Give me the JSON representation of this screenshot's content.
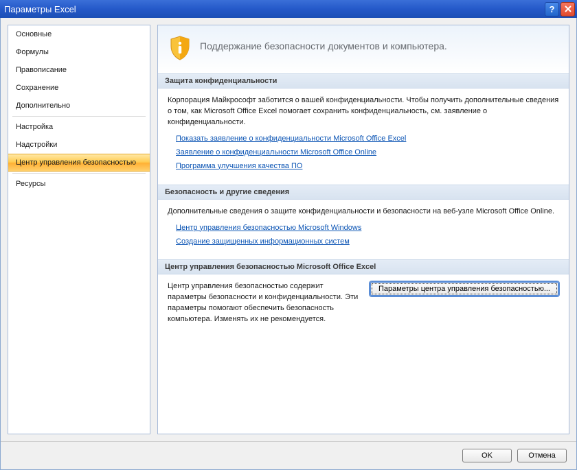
{
  "window": {
    "title": "Параметры Excel"
  },
  "sidebar": {
    "groups": [
      [
        "Основные",
        "Формулы",
        "Правописание",
        "Сохранение",
        "Дополнительно"
      ],
      [
        "Настройка",
        "Надстройки",
        "Центр управления безопасностью"
      ],
      [
        "Ресурсы"
      ]
    ],
    "selected": "Центр управления безопасностью"
  },
  "banner": {
    "text": "Поддержание безопасности документов и компьютера."
  },
  "sections": {
    "privacy": {
      "title": "Защита конфиденциальности",
      "body": "Корпорация Майкрософт заботится о вашей конфиденциальности. Чтобы получить дополнительные сведения о том, как Microsoft Office Excel помогает сохранить конфиденциальность, см. заявление о конфиденциальности.",
      "links": [
        "Показать заявление о конфиденциальности Microsoft Office Excel",
        "Заявление о конфиденциальности Microsoft Office Online",
        "Программа улучшения качества ПО"
      ]
    },
    "security": {
      "title": "Безопасность и другие сведения",
      "body": "Дополнительные сведения о защите конфиденциальности и безопасности на веб-узле Microsoft Office Online.",
      "links": [
        "Центр управления безопасностью Microsoft Windows",
        "Создание защищенных информационных систем"
      ]
    },
    "trust_center": {
      "title": "Центр управления безопасностью Microsoft Office Excel",
      "body": "Центр управления безопасностью содержит параметры безопасности и конфиденциальности. Эти параметры помогают обеспечить безопасность компьютера. Изменять их не рекомендуется.",
      "button": "Параметры центра управления безопасностью..."
    }
  },
  "buttons": {
    "ok": "OK",
    "cancel": "Отмена"
  }
}
